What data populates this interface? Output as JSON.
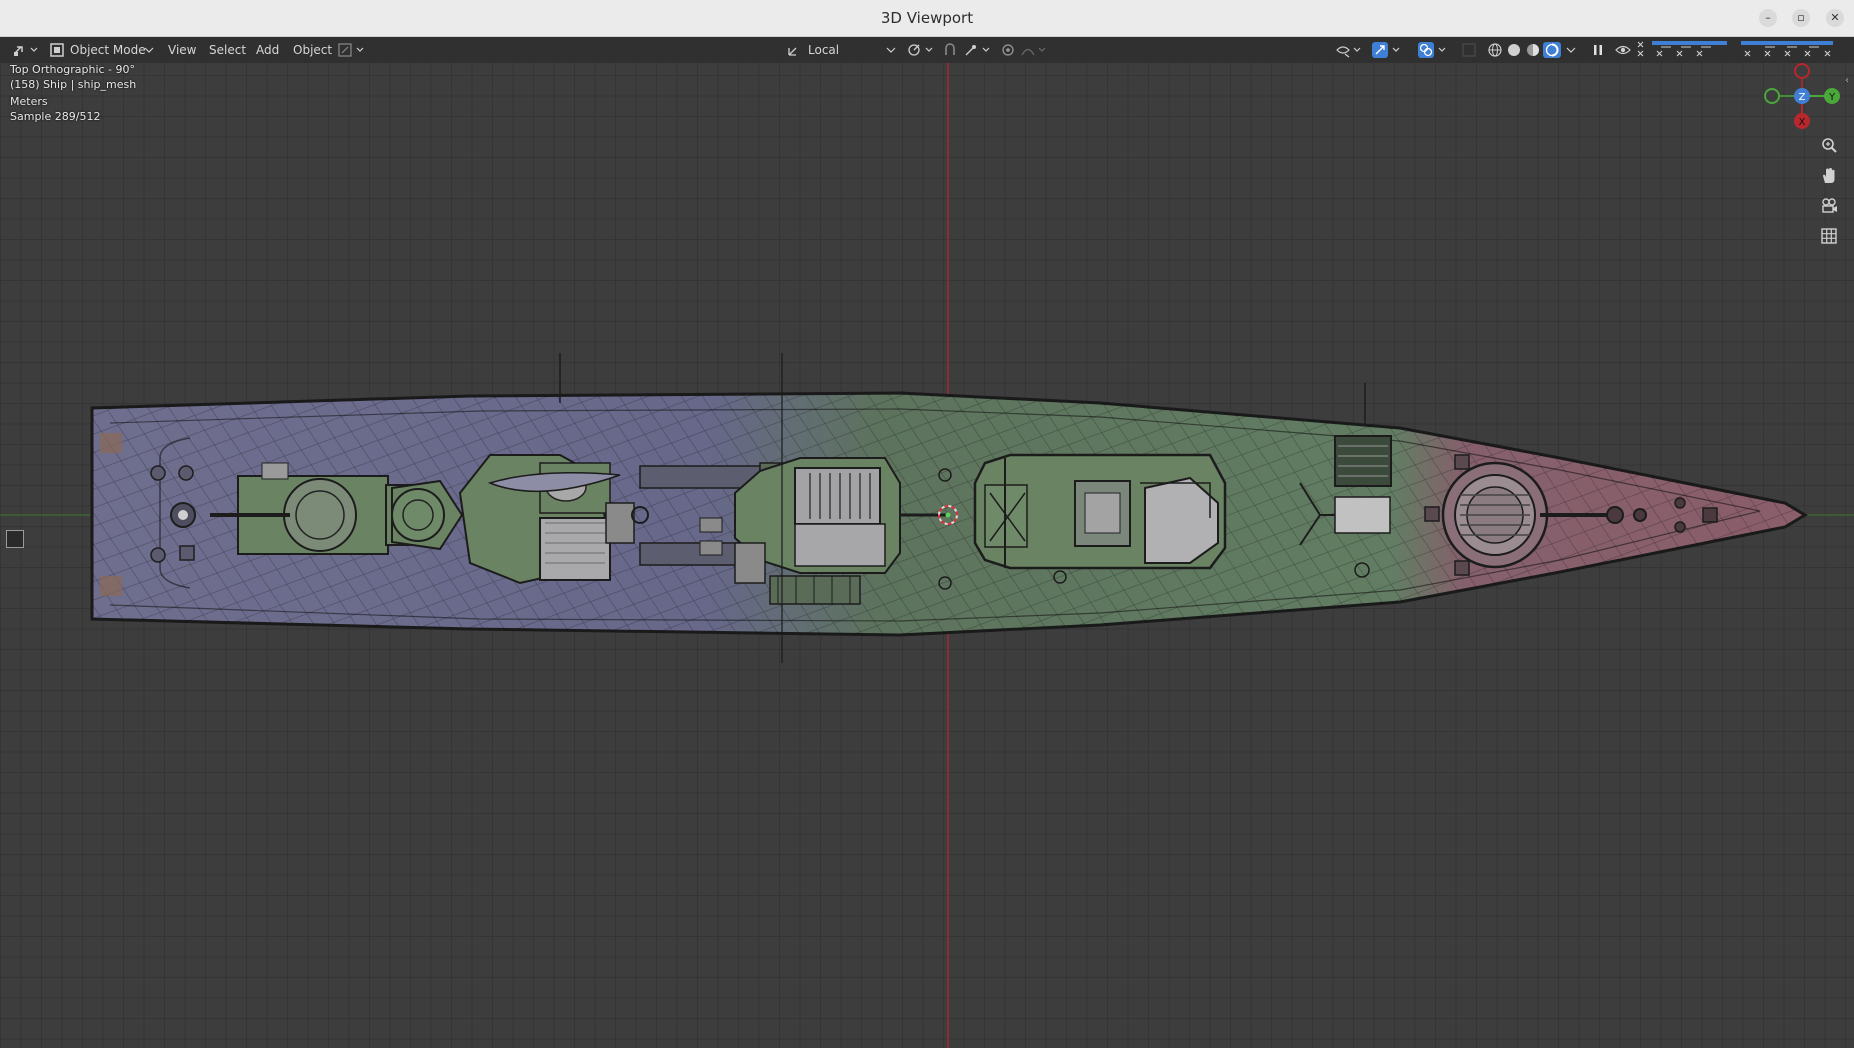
{
  "window": {
    "title": "3D Viewport"
  },
  "header": {
    "mode_label": "Object Mode",
    "menus": [
      "View",
      "Select",
      "Add",
      "Object"
    ],
    "transform_orientation": "Local"
  },
  "viewport": {
    "overlay": {
      "view_name": "Top Orthographic - 90°",
      "object_info": "(158) Ship | ship_mesh",
      "units": "Meters",
      "sample": "Sample 289/512"
    },
    "gizmo": {
      "z_label": "Z",
      "y_label": "Y",
      "x_label": "X"
    }
  },
  "colors": {
    "background": "#3d3d3d",
    "header_bg": "#303030",
    "accent_blue": "#3f7fd6",
    "axis_red": "#b8272d",
    "axis_green": "#4aa83a",
    "hull_stern": "#6f6c8e",
    "hull_mid": "#5f7a61",
    "hull_bow": "#86606a"
  }
}
